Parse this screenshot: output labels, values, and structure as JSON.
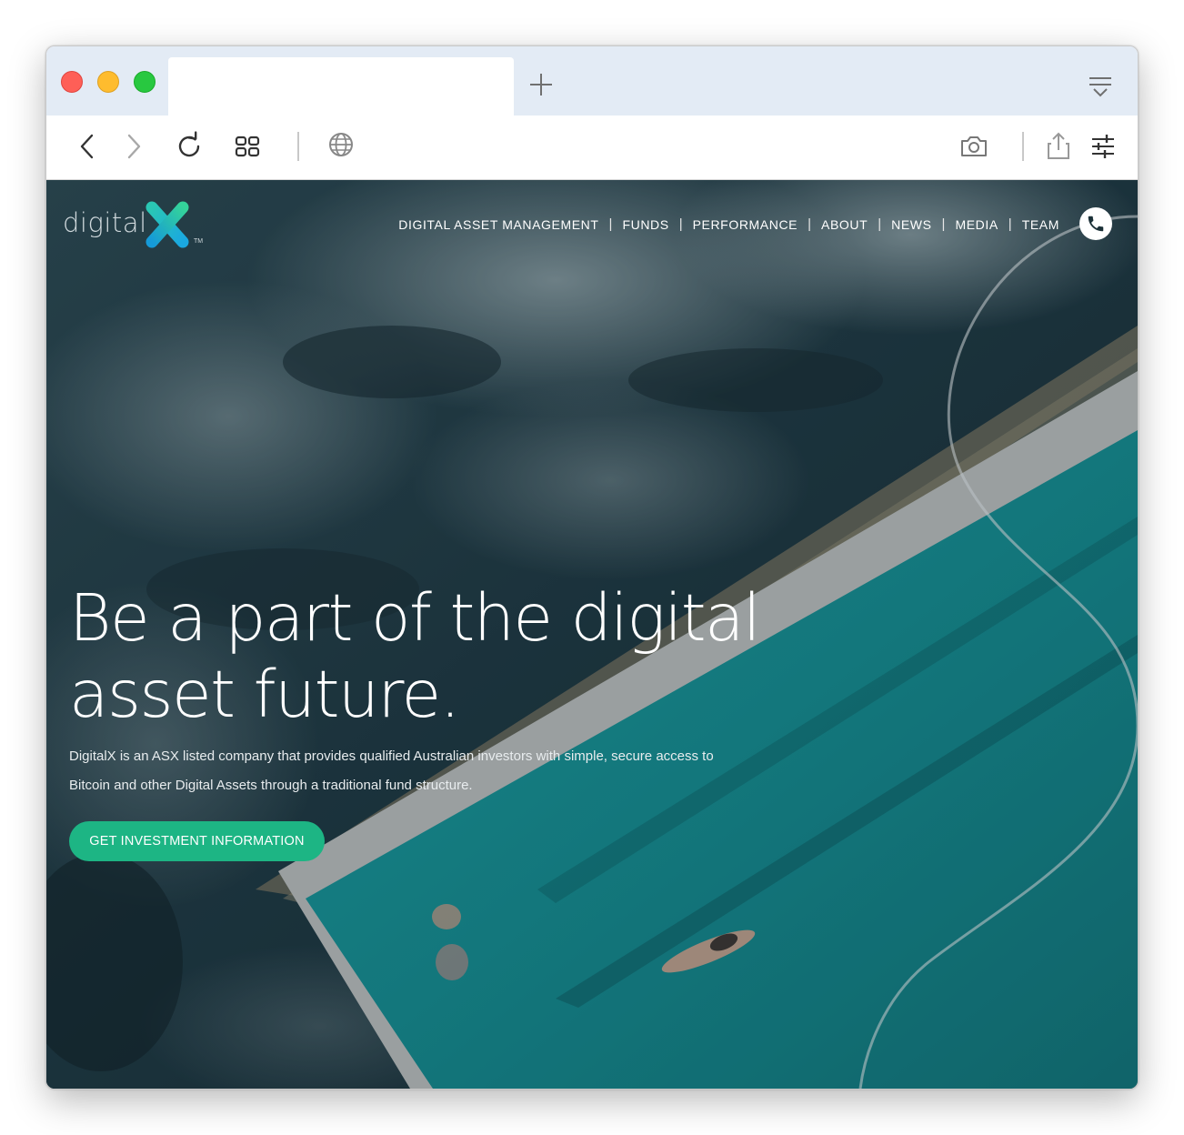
{
  "browser": {
    "active_tab_title": "",
    "icons": {
      "back": "chevron-left-icon",
      "forward": "chevron-right-icon",
      "reload": "reload-icon",
      "tabs_overview": "grid-icon",
      "site_info": "globe-icon",
      "screenshot": "camera-icon",
      "share": "share-icon",
      "settings": "sliders-icon",
      "new_tab": "plus-icon",
      "tab_menu": "tab-menu-icon"
    }
  },
  "site": {
    "logo": {
      "text": "digital",
      "mark": "X",
      "trademark": "TM"
    },
    "nav": [
      {
        "label": "DIGITAL ASSET MANAGEMENT"
      },
      {
        "label": "FUNDS"
      },
      {
        "label": "PERFORMANCE"
      },
      {
        "label": "ABOUT"
      },
      {
        "label": "NEWS"
      },
      {
        "label": "MEDIA"
      },
      {
        "label": "TEAM"
      }
    ],
    "nav_separator": "|",
    "phone_icon": "phone-icon",
    "hero": {
      "headline_line1": "Be a part of the digital",
      "headline_line2": "asset future.",
      "description_line1": "DigitalX is an ASX listed company that provides qualified Australian investors with simple, secure access to",
      "description_line2": "Bitcoin and other Digital Assets through a traditional fund structure.",
      "cta_label": "GET INVESTMENT INFORMATION"
    }
  },
  "colors": {
    "accent": "#1db584",
    "pool": "#1d9a9a",
    "ocean": "#1e3a44",
    "titlebar": "#e3ebf5"
  }
}
